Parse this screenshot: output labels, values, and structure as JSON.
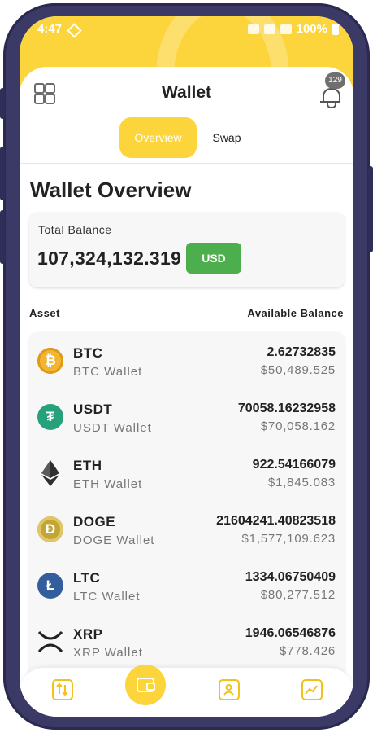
{
  "status": {
    "time": "4:47",
    "battery": "100%"
  },
  "header": {
    "title": "Wallet",
    "badge_count": "129"
  },
  "tabs": {
    "overview": "Overview",
    "swap": "Swap"
  },
  "page_title": "Wallet Overview",
  "balance": {
    "label": "Total Balance",
    "value": "107,324,132.319",
    "currency_button": "USD"
  },
  "columns": {
    "asset": "Asset",
    "available": "Available Balance"
  },
  "assets": [
    {
      "symbol": "BTC",
      "wallet": "BTC Wallet",
      "amount": "2.62732835",
      "usd": "$50,489.525",
      "icon": "bitcoin-icon",
      "color": "#f2b530"
    },
    {
      "symbol": "USDT",
      "wallet": "USDT Wallet",
      "amount": "70058.16232958",
      "usd": "$70,058.162",
      "icon": "tether-icon",
      "color": "#26a17b"
    },
    {
      "symbol": "ETH",
      "wallet": "ETH Wallet",
      "amount": "922.54166079",
      "usd": "$1,845.083",
      "icon": "ethereum-icon",
      "color": "#2f2f2f"
    },
    {
      "symbol": "DOGE",
      "wallet": "DOGE Wallet",
      "amount": "21604241.40823518",
      "usd": "$1,577,109.623",
      "icon": "dogecoin-icon",
      "color": "#c2a633"
    },
    {
      "symbol": "LTC",
      "wallet": "LTC Wallet",
      "amount": "1334.06750409",
      "usd": "$80,277.512",
      "icon": "litecoin-icon",
      "color": "#345d9d"
    },
    {
      "symbol": "XRP",
      "wallet": "XRP Wallet",
      "amount": "1946.06546876",
      "usd": "$778.426",
      "icon": "xrp-icon",
      "color": "#222222"
    }
  ],
  "colors": {
    "accent": "#fbd53b",
    "usd_button": "#4cae4c",
    "frame": "#3b3a66"
  }
}
